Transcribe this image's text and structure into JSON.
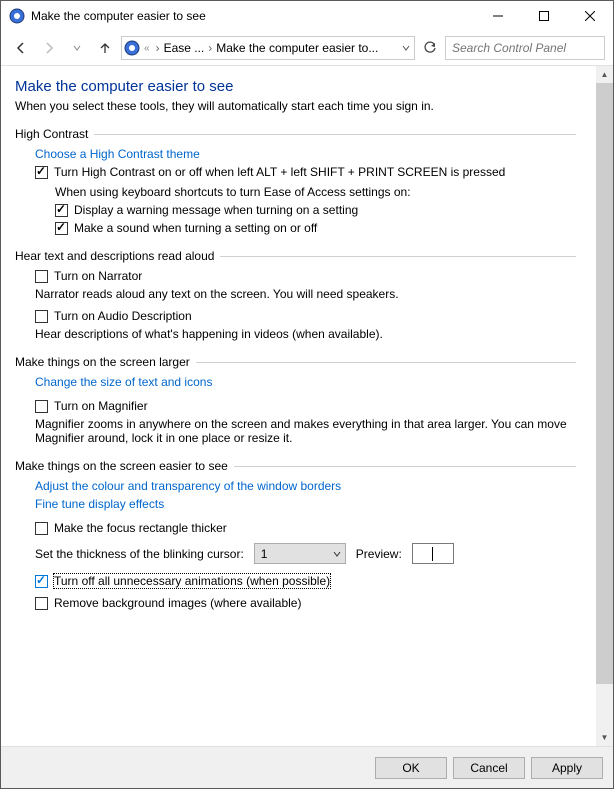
{
  "window": {
    "title": "Make the computer easier to see"
  },
  "breadcrumb": {
    "seg1": "Ease ...",
    "seg2": "Make the computer easier to..."
  },
  "search": {
    "placeholder": "Search Control Panel"
  },
  "page": {
    "heading": "Make the computer easier to see",
    "subtitle": "When you select these tools, they will automatically start each time you sign in."
  },
  "highContrast": {
    "header": "High Contrast",
    "chooseTheme": "Choose a High Contrast theme",
    "toggleShortcut": "Turn High Contrast on or off when left ALT + left SHIFT + PRINT SCREEN is pressed",
    "whenShortcuts": "When using keyboard shortcuts to turn Ease of Access settings on:",
    "displayWarning": "Display a warning message when turning on a setting",
    "makeSound": "Make a sound when turning a setting on or off"
  },
  "readAloud": {
    "header": "Hear text and descriptions read aloud",
    "narrator": "Turn on Narrator",
    "narratorDesc": "Narrator reads aloud any text on the screen. You will need speakers.",
    "audioDesc": "Turn on Audio Description",
    "audioDescDesc": "Hear descriptions of what's happening in videos (when available)."
  },
  "larger": {
    "header": "Make things on the screen larger",
    "changeSize": "Change the size of text and icons",
    "magnifier": "Turn on Magnifier",
    "magnifierDesc": "Magnifier zooms in anywhere on the screen and makes everything in that area larger. You can move Magnifier around, lock it in one place or resize it."
  },
  "easier": {
    "header": "Make things on the screen easier to see",
    "adjustColour": "Adjust the colour and transparency of the window borders",
    "fineTune": "Fine tune display effects",
    "focusRect": "Make the focus rectangle thicker",
    "cursorLabel": "Set the thickness of the blinking cursor:",
    "cursorValue": "1",
    "previewLabel": "Preview:",
    "turnOffAnim": "Turn off all unnecessary animations (when possible)",
    "removeBg": "Remove background images (where available)"
  },
  "buttons": {
    "ok": "OK",
    "cancel": "Cancel",
    "apply": "Apply"
  }
}
